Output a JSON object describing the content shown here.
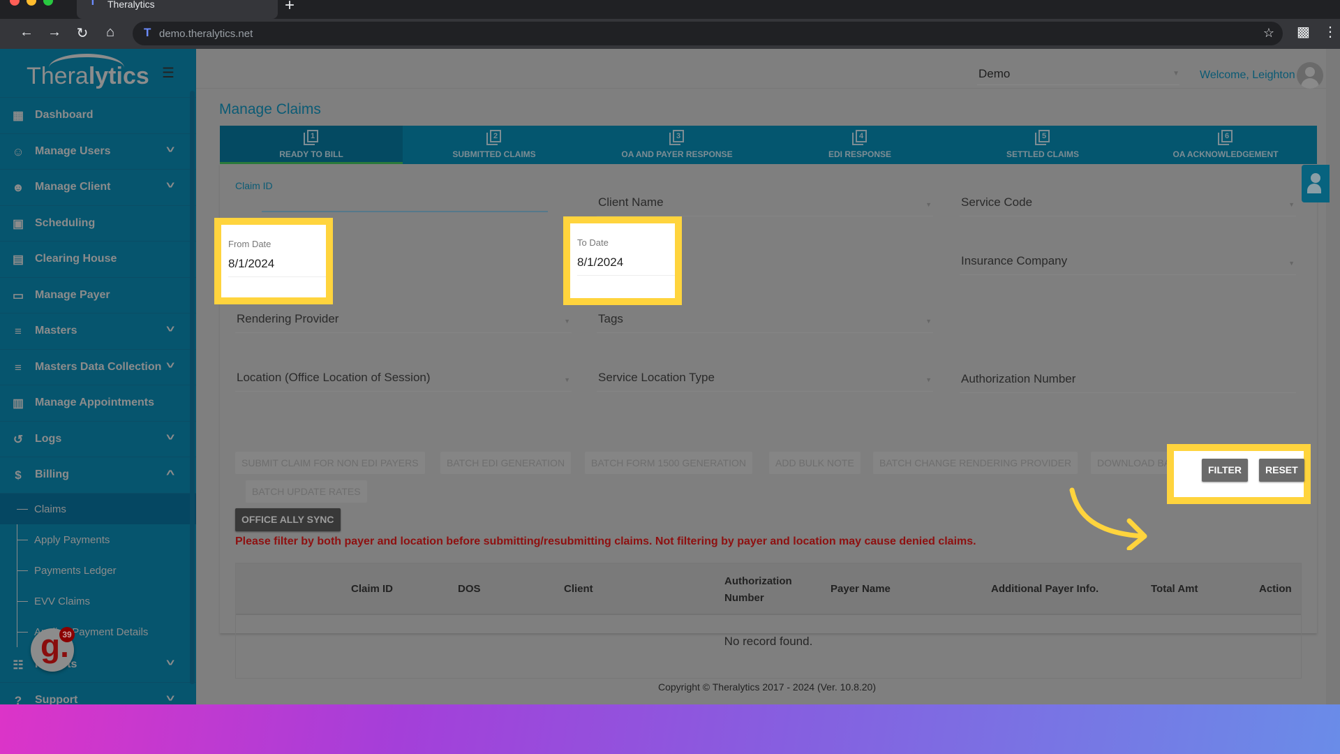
{
  "browser": {
    "tab_title": "Theralytics",
    "url": "demo.theralytics.net",
    "new_tab": "+"
  },
  "sidebar": {
    "logo": {
      "light": "Thera",
      "bold": "lytics"
    },
    "items": [
      {
        "label": "Dashboard",
        "icon": "dashboard-icon",
        "has_chevron": false
      },
      {
        "label": "Manage Users",
        "icon": "users-icon",
        "has_chevron": true
      },
      {
        "label": "Manage Client",
        "icon": "person-icon",
        "has_chevron": true
      },
      {
        "label": "Scheduling",
        "icon": "calendar-icon",
        "has_chevron": false
      },
      {
        "label": "Clearing House",
        "icon": "clearing-house-icon",
        "has_chevron": false
      },
      {
        "label": "Manage Payer",
        "icon": "payer-icon",
        "has_chevron": false
      },
      {
        "label": "Masters",
        "icon": "database-icon",
        "has_chevron": true
      },
      {
        "label": "Masters Data Collection",
        "icon": "database-icon",
        "has_chevron": true
      },
      {
        "label": "Manage Appointments",
        "icon": "appointments-icon",
        "has_chevron": false
      },
      {
        "label": "Logs",
        "icon": "history-icon",
        "has_chevron": true
      },
      {
        "label": "Billing",
        "icon": "dollar-icon",
        "has_chevron": true,
        "expanded": true
      }
    ],
    "billing_sub": [
      {
        "label": "Claims",
        "active": true
      },
      {
        "label": "Apply Payments"
      },
      {
        "label": "Payments Ledger"
      },
      {
        "label": "EVV Claims"
      },
      {
        "label": "Applied Payment Details"
      }
    ],
    "after_items": [
      {
        "label": "Reports",
        "icon": "clipboard-icon",
        "has_chevron": true
      },
      {
        "label": "Support",
        "icon": "help-icon",
        "has_chevron": true
      }
    ]
  },
  "header": {
    "org_select_value": "Demo",
    "welcome": "Welcome, Leighton"
  },
  "page": {
    "title": "Manage Claims",
    "tabs": [
      {
        "num": "1",
        "label": "READY TO BILL",
        "active": true
      },
      {
        "num": "2",
        "label": "SUBMITTED CLAIMS"
      },
      {
        "num": "3",
        "label": "OA AND PAYER RESPONSE"
      },
      {
        "num": "4",
        "label": "EDI RESPONSE"
      },
      {
        "num": "5",
        "label": "SETTLED CLAIMS"
      },
      {
        "num": "6",
        "label": "OA ACKNOWLEDGEMENT"
      }
    ],
    "filters": {
      "claim_id_label": "Claim ID",
      "claim_id_value": "",
      "client_name": "Client Name",
      "service_code": "Service Code",
      "from_date_label": "From Date",
      "from_date_value": "8/1/2024",
      "to_date_label": "To Date",
      "to_date_value": "8/1/2024",
      "insurance_company": "Insurance Company",
      "rendering_provider": "Rendering Provider",
      "tags": "Tags",
      "location": "Location (Office Location of Session)",
      "service_location_type": "Service Location Type",
      "authorization_number": "Authorization Number"
    },
    "actions": {
      "submit_non_edi": "SUBMIT CLAIM FOR NON EDI PAYERS",
      "batch_edi": "BATCH EDI GENERATION",
      "batch_1500": "BATCH FORM 1500 GENERATION",
      "add_bulk_note": "ADD BULK NOTE",
      "batch_change_provider": "BATCH CHANGE RENDERING PROVIDER",
      "download_batch_edi": "DOWNLOAD BATCH EDI",
      "batch_update_rates": "BATCH UPDATE RATES",
      "office_ally_sync": "OFFICE ALLY SYNC",
      "filter": "FILTER",
      "reset": "RESET"
    },
    "warning": "Please filter by both payer and location before submitting/resubmitting claims. Not filtering by payer and location may cause denied claims.",
    "table": {
      "columns": [
        "Claim ID",
        "DOS",
        "Client",
        "Authorization Number",
        "Payer Name",
        "Additional Payer Info.",
        "Total Amt",
        "Action"
      ],
      "auth_col_line1": "Authorization",
      "auth_col_line2": "Number",
      "rows": [],
      "empty_message": "No record found."
    },
    "copyright": "Copyright © Theralytics 2017 - 2024 (Ver. 10.8.20)"
  },
  "widget": {
    "badge_letter": "g.",
    "badge_count": "39"
  },
  "colors": {
    "sidebar_bg": "#06556e",
    "tab_bar": "#04566f",
    "highlight": "#ffd43d",
    "warning": "#8e1010"
  }
}
